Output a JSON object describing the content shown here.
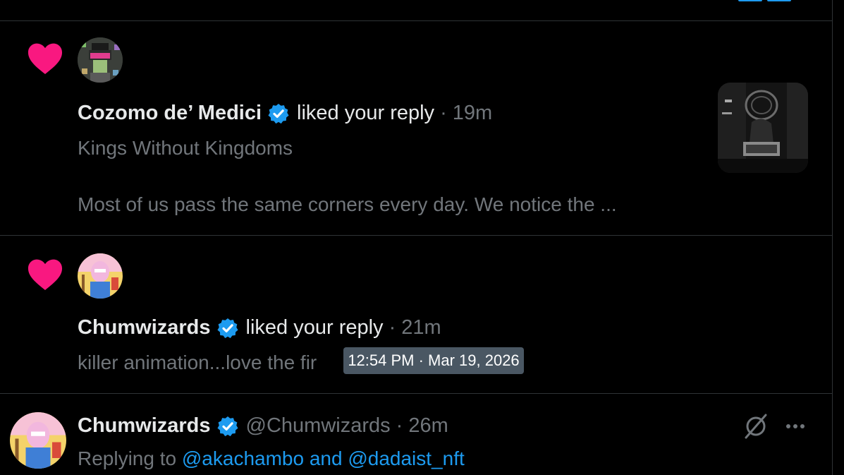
{
  "notifications": [
    {
      "type": "like",
      "user_name": "Cozomo de’ Medici",
      "action": "liked your reply",
      "separator": "·",
      "time": "19m",
      "post_title": "Kings Without Kingdoms",
      "post_excerpt": "Most of us pass the same corners every day. We notice the ..."
    },
    {
      "type": "like",
      "user_name": "Chumwizards",
      "action": "liked your reply",
      "separator": "·",
      "time": "21m",
      "post_excerpt": "killer animation...love the fir"
    }
  ],
  "tooltip": {
    "text": "12:54 PM · Mar 19, 2026"
  },
  "reply_post": {
    "user_name": "Chumwizards",
    "handle": "@Chumwizards",
    "separator": "·",
    "time": "26m",
    "replying_prefix": "Replying to",
    "replying_to_1": "@akachambo",
    "replying_and": "and",
    "replying_to_2": "@dadaist_nft"
  },
  "icons": {
    "like": "heart-icon",
    "verified": "verified-badge-icon",
    "grok": "grok-icon",
    "more": "more-icon"
  },
  "colors": {
    "heart": "#f91880",
    "verified": "#1d9bf0",
    "link": "#1d9bf0",
    "secondary_text": "#71767b",
    "divider": "#2f3336",
    "tooltip_bg": "#4a5763"
  }
}
